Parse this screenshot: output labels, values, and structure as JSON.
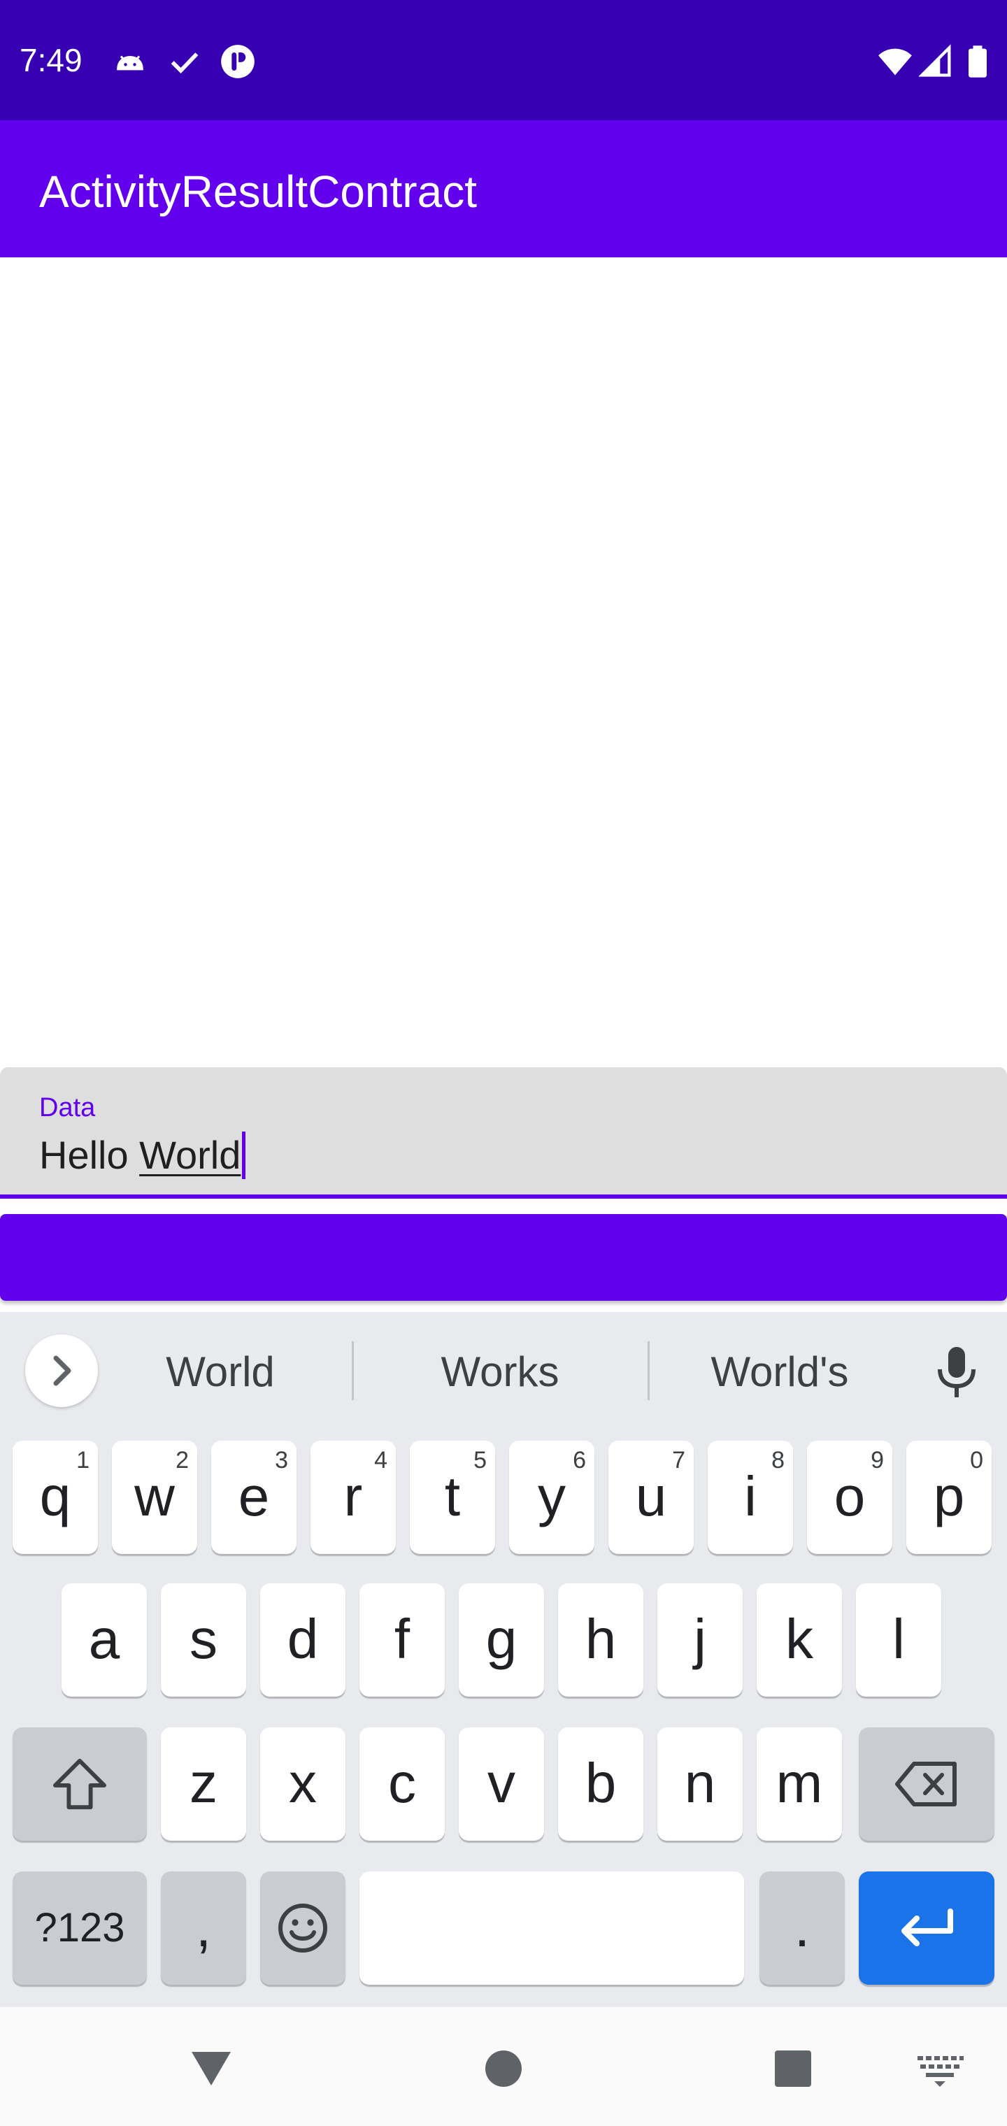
{
  "status_bar": {
    "time": "7:49",
    "left_icons": [
      "android-icon",
      "check-icon",
      "app-badge-icon"
    ],
    "right_icons": [
      "wifi-icon",
      "cell-signal-icon",
      "battery-icon"
    ]
  },
  "app_bar": {
    "title": "ActivityResultContract",
    "color": "#6200ee",
    "status_color": "#3700b3"
  },
  "text_field": {
    "label": "Data",
    "value_plain": "Hello ",
    "value_composing": "World",
    "accent": "#6200ee"
  },
  "action_button": {
    "label": ""
  },
  "keyboard": {
    "suggestions": [
      "World",
      "Works",
      "World's"
    ],
    "row1": [
      {
        "key": "q",
        "hint": "1"
      },
      {
        "key": "w",
        "hint": "2"
      },
      {
        "key": "e",
        "hint": "3"
      },
      {
        "key": "r",
        "hint": "4"
      },
      {
        "key": "t",
        "hint": "5"
      },
      {
        "key": "y",
        "hint": "6"
      },
      {
        "key": "u",
        "hint": "7"
      },
      {
        "key": "i",
        "hint": "8"
      },
      {
        "key": "o",
        "hint": "9"
      },
      {
        "key": "p",
        "hint": "0"
      }
    ],
    "row2": [
      "a",
      "s",
      "d",
      "f",
      "g",
      "h",
      "j",
      "k",
      "l"
    ],
    "row3": [
      "z",
      "x",
      "c",
      "v",
      "b",
      "n",
      "m"
    ],
    "symbols_label": "?123",
    "comma_label": ",",
    "period_label": ".",
    "enter_color": "#1a73e8"
  },
  "nav_bar": {
    "icons": [
      "back-icon",
      "home-icon",
      "recents-icon",
      "keyboard-switch-icon"
    ]
  }
}
